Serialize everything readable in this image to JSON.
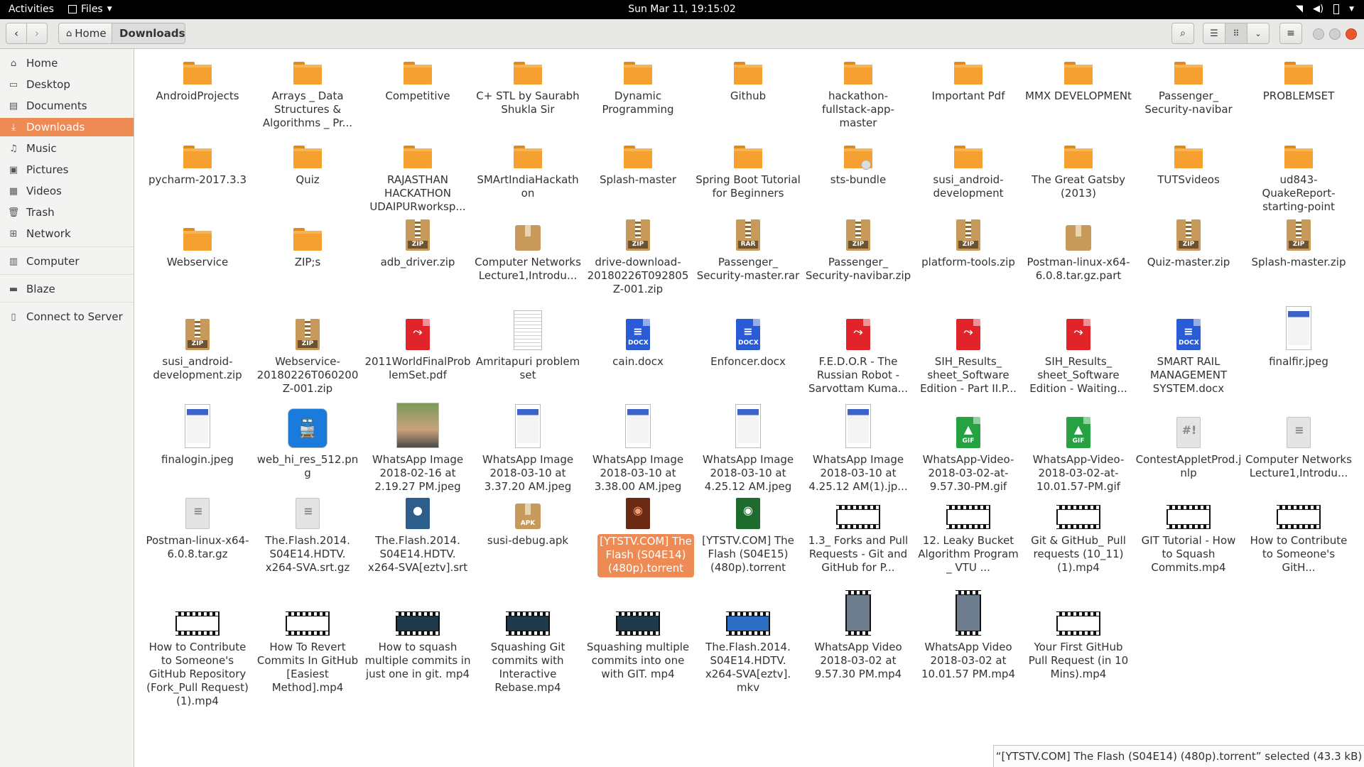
{
  "topbar": {
    "activities": "Activities",
    "app_menu": "Files",
    "clock": "Sun Mar 11, 19:15:02"
  },
  "header": {
    "breadcrumb_home": "Home",
    "breadcrumb_current": "Downloads"
  },
  "sidebar": {
    "items": [
      {
        "label": "Home",
        "icon": "home-icon"
      },
      {
        "label": "Desktop",
        "icon": "desktop-icon"
      },
      {
        "label": "Documents",
        "icon": "documents-icon"
      },
      {
        "label": "Downloads",
        "icon": "download-icon",
        "active": true
      },
      {
        "label": "Music",
        "icon": "music-icon"
      },
      {
        "label": "Pictures",
        "icon": "pictures-icon"
      },
      {
        "label": "Videos",
        "icon": "videos-icon"
      },
      {
        "label": "Trash",
        "icon": "trash-icon"
      },
      {
        "label": "Network",
        "icon": "network-icon"
      },
      {
        "label": "Computer",
        "icon": "computer-icon"
      },
      {
        "label": "Blaze",
        "icon": "drive-icon"
      },
      {
        "label": "Connect to Server",
        "icon": "server-icon"
      }
    ]
  },
  "files": [
    {
      "name": "AndroidProjects",
      "type": "folder"
    },
    {
      "name": "Arrays _ Data Structures & Algorithms _ Pr...",
      "type": "folder"
    },
    {
      "name": "Competitive",
      "type": "folder"
    },
    {
      "name": "C+ STL by Saurabh Shukla Sir",
      "type": "folder"
    },
    {
      "name": "Dynamic Programming",
      "type": "folder"
    },
    {
      "name": "Github",
      "type": "folder"
    },
    {
      "name": "hackathon-fullstack-app-master",
      "type": "folder"
    },
    {
      "name": "Important Pdf",
      "type": "folder"
    },
    {
      "name": "MMX DEVELOPMENt",
      "type": "folder"
    },
    {
      "name": "Passenger_ Security-navibar",
      "type": "folder"
    },
    {
      "name": "PROBLEMSET",
      "type": "folder"
    },
    {
      "name": "pycharm-2017.3.3",
      "type": "folder"
    },
    {
      "name": "Quiz",
      "type": "folder"
    },
    {
      "name": "RAJASTHAN HACKATHON UDAIPURworksp...",
      "type": "folder"
    },
    {
      "name": "SMArtIndiaHackathon",
      "type": "folder"
    },
    {
      "name": "Splash-master",
      "type": "folder"
    },
    {
      "name": "Spring Boot Tutorial for Beginners",
      "type": "folder"
    },
    {
      "name": "sts-bundle",
      "type": "folder-locked"
    },
    {
      "name": "susi_android-development",
      "type": "folder"
    },
    {
      "name": "The Great Gatsby (2013)",
      "type": "folder"
    },
    {
      "name": "TUTSvideos",
      "type": "folder"
    },
    {
      "name": "ud843-QuakeReport-starting-point",
      "type": "folder"
    },
    {
      "name": "Webservice",
      "type": "folder"
    },
    {
      "name": "ZIP;s",
      "type": "folder"
    },
    {
      "name": "adb_driver.zip",
      "type": "zip",
      "tag": "ZIP"
    },
    {
      "name": "Computer Networks Lecture1,Introdu...",
      "type": "package"
    },
    {
      "name": "drive-download-20180226T092805Z-001.zip",
      "type": "zip",
      "tag": "ZIP"
    },
    {
      "name": "Passenger_ Security-master.rar",
      "type": "zip",
      "tag": "RAR"
    },
    {
      "name": "Passenger_ Security-navibar.zip",
      "type": "zip",
      "tag": "ZIP"
    },
    {
      "name": "platform-tools.zip",
      "type": "zip",
      "tag": "ZIP"
    },
    {
      "name": "Postman-linux-x64-6.0.8.tar.gz.part",
      "type": "package"
    },
    {
      "name": "Quiz-master.zip",
      "type": "zip",
      "tag": "ZIP"
    },
    {
      "name": "Splash-master.zip",
      "type": "zip",
      "tag": "ZIP"
    },
    {
      "name": "susi_android-development.zip",
      "type": "zip",
      "tag": "ZIP"
    },
    {
      "name": "Webservice-20180226T060200Z-001.zip",
      "type": "zip",
      "tag": "ZIP"
    },
    {
      "name": "2011WorldFinalProblemSet.pdf",
      "type": "pdf"
    },
    {
      "name": "Amritapuri problem set",
      "type": "photo-doc"
    },
    {
      "name": "cain.docx",
      "type": "docx",
      "tag": "DOCX"
    },
    {
      "name": "Enfoncer.docx",
      "type": "docx",
      "tag": "DOCX"
    },
    {
      "name": "F.E.D.O.R - The Russian Robot - Sarvottam Kuma...",
      "type": "pdf"
    },
    {
      "name": "SIH_Results_ sheet_Software Edition - Part II.P...",
      "type": "pdf"
    },
    {
      "name": "SIH_Results_ sheet_Software Edition - Waiting...",
      "type": "pdf"
    },
    {
      "name": "SMART RAIL MANAGEMENT SYSTEM.docx",
      "type": "docx",
      "tag": "DOCX"
    },
    {
      "name": "finalfir.jpeg",
      "type": "photo-phone"
    },
    {
      "name": "finalogin.jpeg",
      "type": "photo-phone"
    },
    {
      "name": "web_hi_res_512.png",
      "type": "photo-train"
    },
    {
      "name": "WhatsApp Image 2018-02-16 at 2.19.27 PM.jpeg",
      "type": "photo-person"
    },
    {
      "name": "WhatsApp Image 2018-03-10 at 3.37.20 AM.jpeg",
      "type": "photo-phone"
    },
    {
      "name": "WhatsApp Image 2018-03-10 at 3.38.00 AM.jpeg",
      "type": "photo-phone"
    },
    {
      "name": "WhatsApp Image 2018-03-10 at 4.25.12 AM.jpeg",
      "type": "photo-phone"
    },
    {
      "name": "WhatsApp Image 2018-03-10 at 4.25.12 AM(1).jp...",
      "type": "photo-phone"
    },
    {
      "name": "WhatsApp-Video-2018-03-02-at-9.57.30-PM.gif",
      "type": "gif",
      "tag": "GIF"
    },
    {
      "name": "WhatsApp-Video-2018-03-02-at-10.01.57-PM.gif",
      "type": "gif",
      "tag": "GIF"
    },
    {
      "name": "ContestAppletProd.jnlp",
      "type": "text",
      "glyph": "#!"
    },
    {
      "name": "Computer Networks Lecture1,Introdu...",
      "type": "text"
    },
    {
      "name": "Postman-linux-x64-6.0.8.tar.gz",
      "type": "text"
    },
    {
      "name": "The.Flash.2014. S04E14.HDTV. x264-SVA.srt.gz",
      "type": "text"
    },
    {
      "name": "The.Flash.2014. S04E14.HDTV. x264-SVA[eztv].srt",
      "type": "subtitle"
    },
    {
      "name": "susi-debug.apk",
      "type": "package",
      "tag": "APK"
    },
    {
      "name": "[YTSTV.COM] The Flash (S04E14) (480p).torrent",
      "type": "torrent",
      "selected": true
    },
    {
      "name": "[YTSTV.COM] The Flash (S04E15) (480p).torrent",
      "type": "torrent"
    },
    {
      "name": "1.3_ Forks and Pull Requests - Git and GitHub for P...",
      "type": "video"
    },
    {
      "name": "12. Leaky Bucket Algorithm Program _ VTU ...",
      "type": "video"
    },
    {
      "name": "Git & GitHub_ Pull requests (10_11) (1).mp4",
      "type": "video"
    },
    {
      "name": "GIT Tutorial - How to Squash Commits.mp4",
      "type": "video"
    },
    {
      "name": "How to Contribute to Someone's GitH...",
      "type": "video"
    },
    {
      "name": "How to Contribute to Someone's GitHub Repository (Fork_Pull Request)(1).mp4",
      "type": "video"
    },
    {
      "name": "How To Revert Commits In GitHub [Easiest Method].mp4",
      "type": "video"
    },
    {
      "name": "How to squash multiple commits in just one in git. mp4",
      "type": "video-dark"
    },
    {
      "name": "Squashing Git commits with Interactive Rebase.mp4",
      "type": "video-dark"
    },
    {
      "name": "Squashing multiple commits into one with GIT. mp4",
      "type": "video-dark"
    },
    {
      "name": "The.Flash.2014. S04E14.HDTV. x264-SVA[eztv]. mkv",
      "type": "video-blue"
    },
    {
      "name": "WhatsApp Video 2018-03-02 at 9.57.30 PM.mp4",
      "type": "video-tall"
    },
    {
      "name": "WhatsApp Video 2018-03-02 at 10.01.57 PM.mp4",
      "type": "video-tall"
    },
    {
      "name": "Your First GitHub Pull Request (in 10 Mins).mp4",
      "type": "video"
    }
  ],
  "colors": {
    "folder": "#f6a031",
    "selection": "#ee8a53",
    "pdf": "#e0242a",
    "docx": "#2a5bd7",
    "gif": "#27a243",
    "archive": "#c79a5b"
  },
  "status": "“[YTSTV.COM] The Flash (S04E14) (480p).torrent” selected (43.3 kB)"
}
